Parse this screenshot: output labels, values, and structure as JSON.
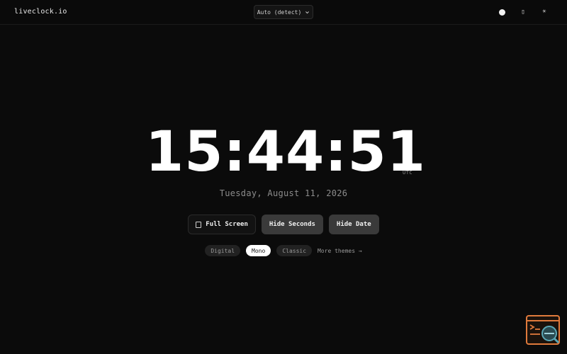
{
  "header": {
    "brand": "liveclock.io",
    "timezone_select": "Auto (detect)",
    "icons": [
      "theme-dot-icon",
      "fullscreen-icon",
      "brightness-icon"
    ],
    "icon_glyphs": {
      "fullscreen": "▯",
      "brightness": "☀"
    }
  },
  "clock": {
    "time": "15:44:51",
    "timezone": "UTC",
    "date": "Tuesday, August 11, 2026"
  },
  "actions": {
    "full_screen": "Full Screen",
    "hide_seconds": "Hide Seconds",
    "hide_date": "Hide Date"
  },
  "themes": {
    "items": [
      "Digital",
      "Mono",
      "Classic"
    ],
    "active": "Mono",
    "more": "More themes →"
  },
  "colors": {
    "background": "#0b0b0b",
    "text": "#ffffff",
    "muted": "#8c8c8c",
    "button": "#3a3a3a",
    "widget_accent": "#e07a3c",
    "widget_teal": "#5aa7b5"
  }
}
